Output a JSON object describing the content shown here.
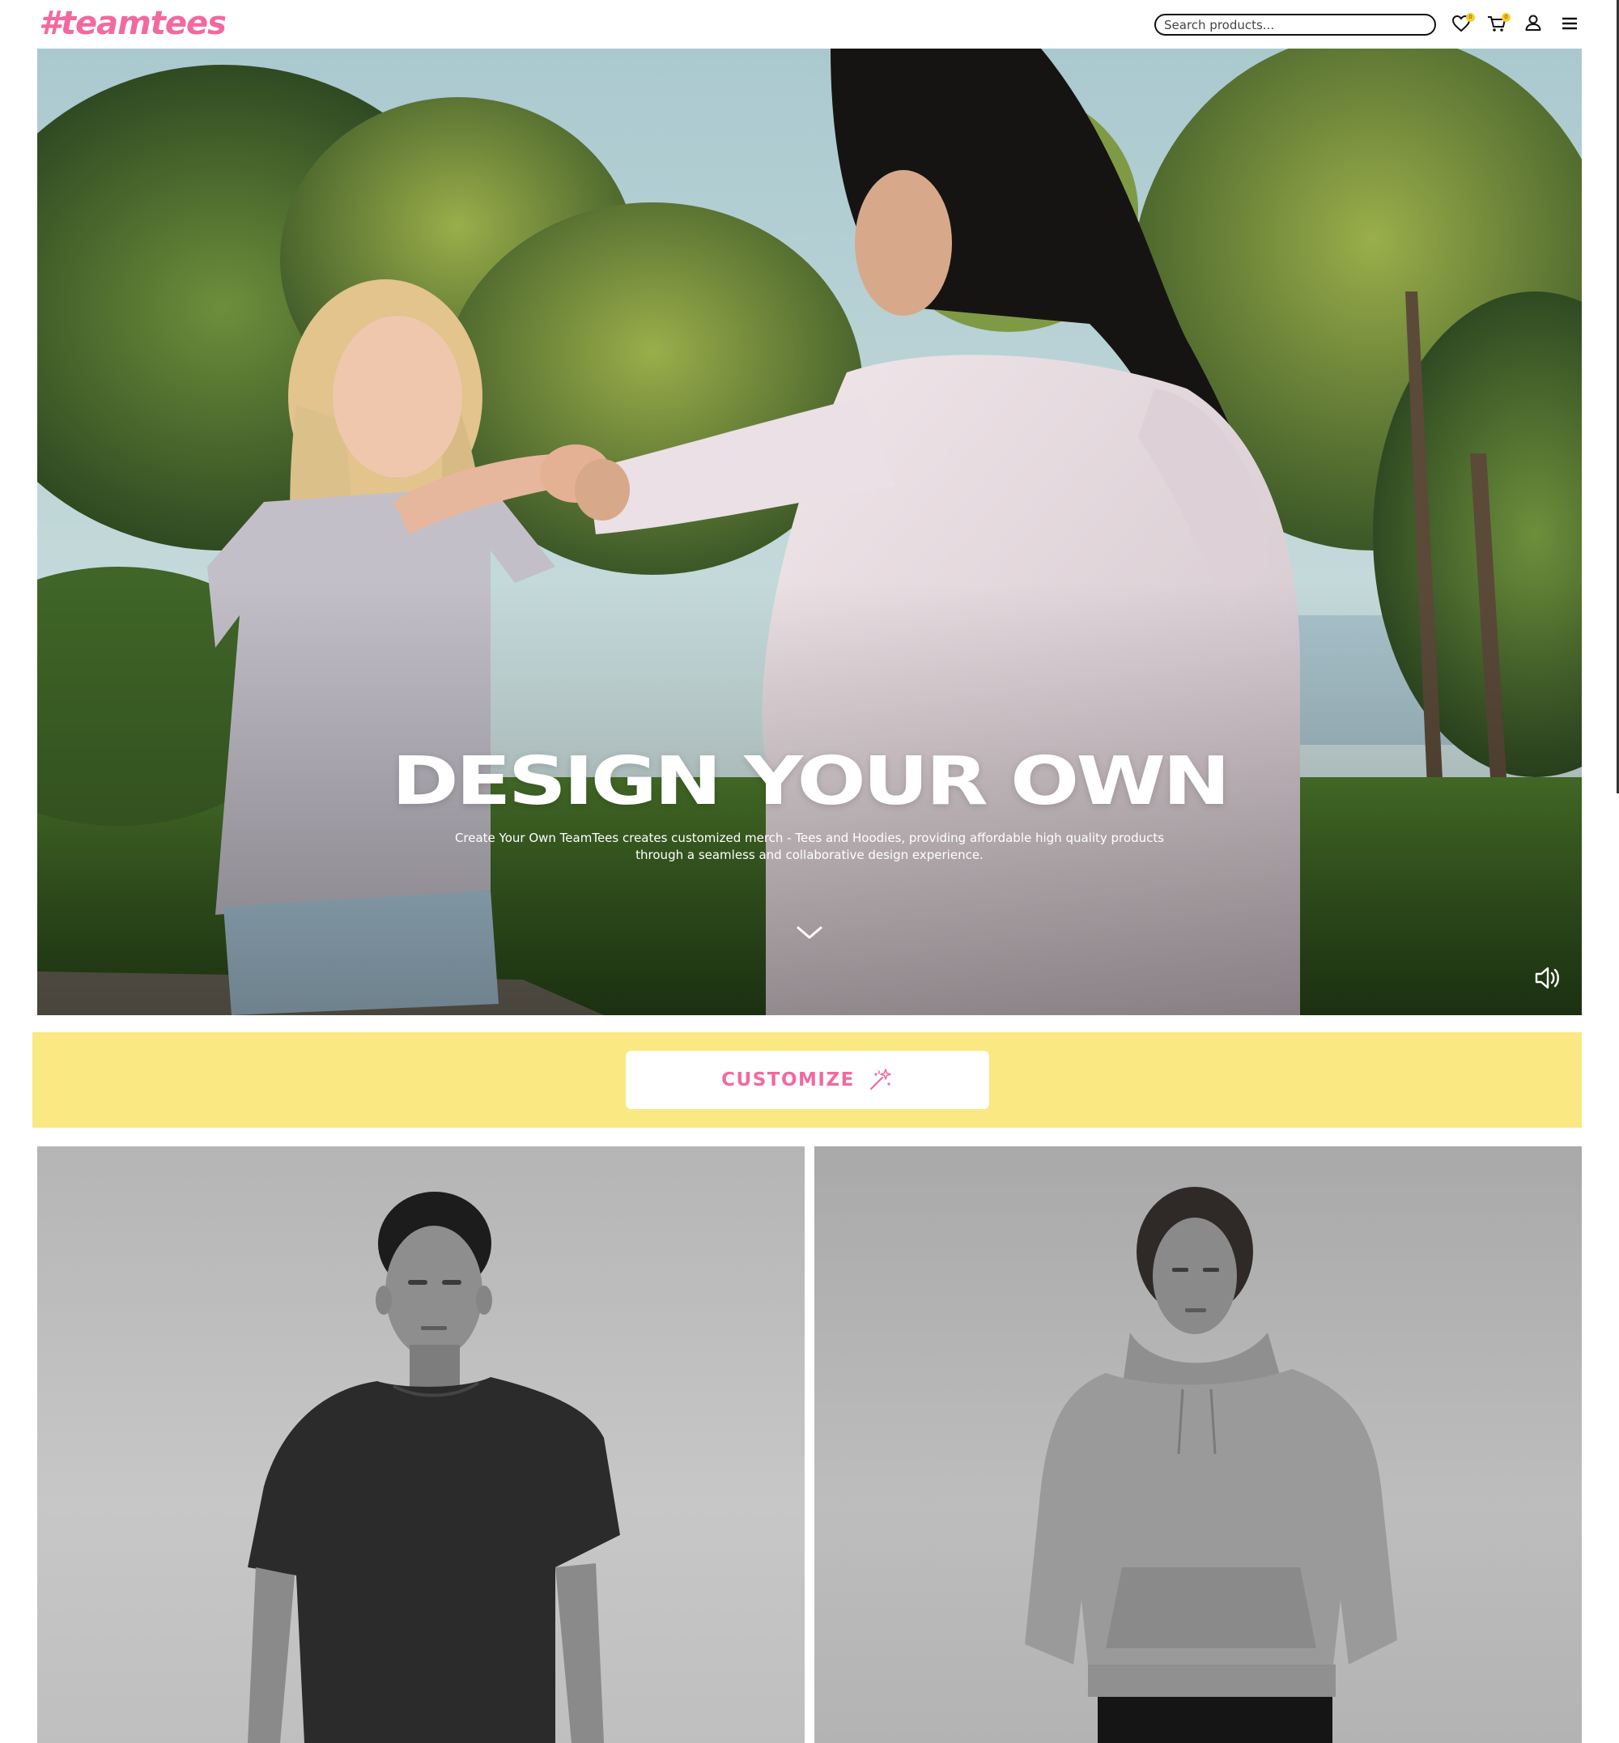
{
  "header": {
    "logo": "#teamtees",
    "search": {
      "placeholder": "Search products..."
    },
    "icons": [
      "heart-icon",
      "cart-icon",
      "user-icon",
      "menu-icon"
    ],
    "wishlist_count": "0",
    "cart_count": "0"
  },
  "hero": {
    "title": "DESIGN YOUR OWN",
    "description_line1": "Create Your Own TeamTees creates customized merch - Tees and Hoodies, providing affordable high quality products",
    "description_line2": "through a seamless and collaborative design experience."
  },
  "cta": {
    "label": "CUSTOMIZE"
  },
  "colors": {
    "brand_pink": "#f2699f",
    "band_yellow": "#fae982",
    "badge_yellow": "#f7cf2b"
  }
}
